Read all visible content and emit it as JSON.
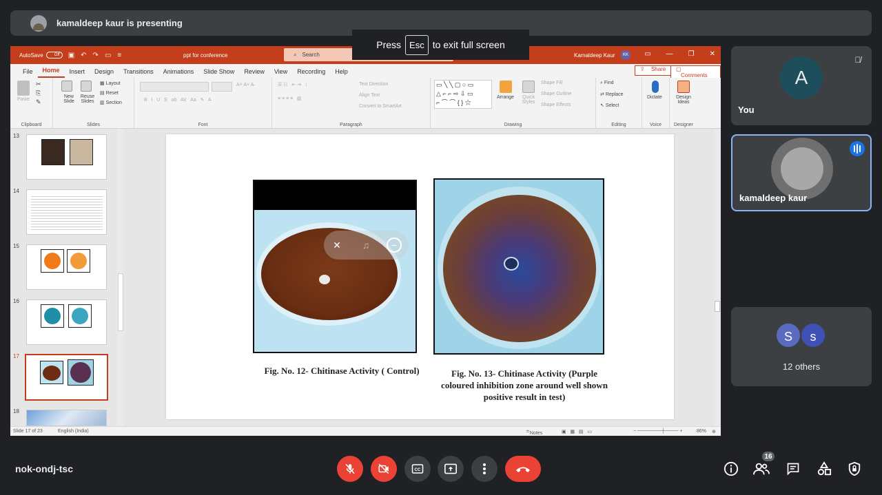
{
  "presenter": {
    "banner": "kamaldeep kaur is presenting"
  },
  "fullscreen_toast": {
    "press": "Press",
    "key": "Esc",
    "rest": "to exit full screen"
  },
  "ppt": {
    "autosave_label": "AutoSave",
    "autosave_state": "Off",
    "doc_title": "ppt for conference",
    "search_placeholder": "Search",
    "user_name": "Kamaldeep Kaur",
    "user_initials": "KK",
    "tabs": [
      "File",
      "Home",
      "Insert",
      "Design",
      "Transitions",
      "Animations",
      "Slide Show",
      "Review",
      "View",
      "Recording",
      "Help"
    ],
    "share_label": "Share",
    "comments_label": "Comments",
    "ribbon": {
      "clipboard": {
        "paste": "Paste",
        "label": "Clipboard"
      },
      "slides": {
        "new_slide": "New Slide",
        "reuse_slides": "Reuse Slides",
        "layout": "Layout",
        "reset": "Reset",
        "section": "Section",
        "label": "Slides"
      },
      "font": {
        "label": "Font"
      },
      "paragraph": {
        "text_direction": "Text Direction",
        "align_text": "Align Text",
        "convert_smartart": "Convert to SmartArt",
        "label": "Paragraph"
      },
      "drawing": {
        "arrange": "Arrange",
        "quick_styles": "Quick Styles",
        "shape_fill": "Shape Fill",
        "shape_outline": "Shape Outline",
        "shape_effects": "Shape Effects",
        "label": "Drawing"
      },
      "editing": {
        "find": "Find",
        "replace": "Replace",
        "select": "Select",
        "label": "Editing"
      },
      "voice": {
        "dictate": "Dictate",
        "label": "Voice"
      },
      "designer": {
        "design_ideas": "Design Ideas",
        "label": "Designer"
      }
    },
    "thumbnails": [
      {
        "num": "13"
      },
      {
        "num": "14"
      },
      {
        "num": "15"
      },
      {
        "num": "16"
      },
      {
        "num": "17",
        "active": true
      },
      {
        "num": "18"
      }
    ],
    "slide": {
      "caption_left": "Fig. No. 12- Chitinase Activity ( Control)",
      "caption_right_1": "Fig. No. 13- Chitinase Activity (Purple",
      "caption_right_2": "coloured  inhibition zone around well shown",
      "caption_right_3": "positive result in test)"
    },
    "status": {
      "slide_info": "Slide 17 of 23",
      "language": "English (India)",
      "notes": "Notes",
      "zoom": "86%"
    }
  },
  "participants": {
    "you": {
      "initial": "A",
      "name": "You"
    },
    "speaker": {
      "name": "kamaldeep kaur"
    },
    "others": {
      "initial_1": "S",
      "initial_2": "s",
      "label": "12 others"
    }
  },
  "bottom_bar": {
    "meeting_code": "nok-ondj-tsc",
    "participant_count": "16"
  },
  "colors": {
    "ppt_accent": "#c43e1c",
    "end_call": "#ea4335",
    "speaking": "#1a73e8"
  }
}
